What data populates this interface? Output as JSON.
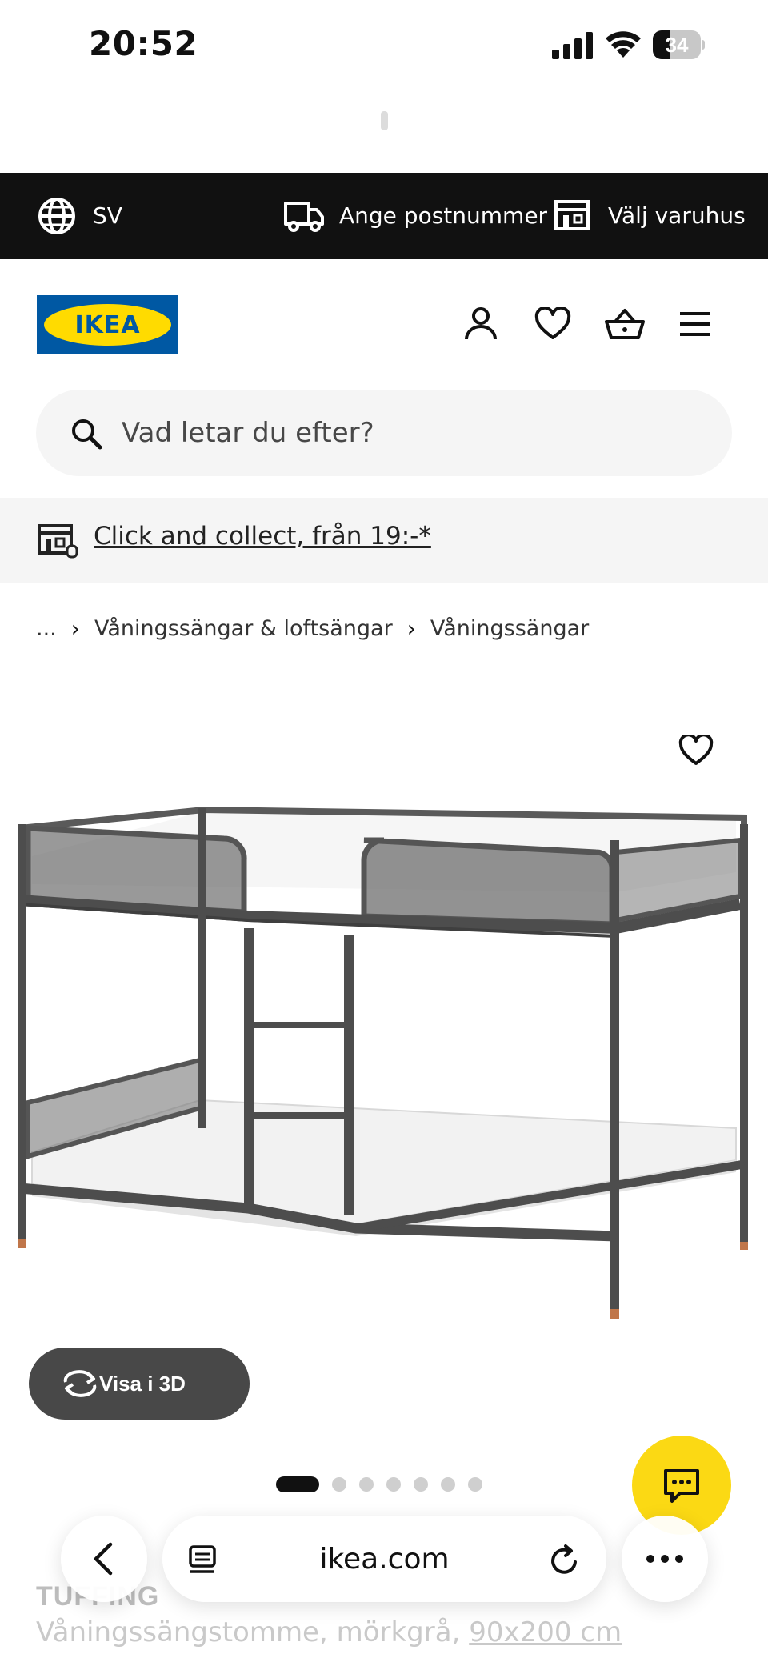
{
  "status_bar": {
    "time": "20:52",
    "battery": "34",
    "icons": [
      "signal-icon",
      "wifi-icon",
      "battery-icon"
    ]
  },
  "top_bar": {
    "language": "SV",
    "postcode_label": "Ange postnummer",
    "store_label": "Välj varuhus",
    "background": "#111111"
  },
  "header": {
    "logo_text": "IKEA",
    "logo_colors": {
      "blue": "#0058a3",
      "yellow": "#ffdb00"
    },
    "icons": [
      "account-icon",
      "favourites-icon",
      "cart-icon",
      "menu-icon"
    ]
  },
  "search": {
    "placeholder": "Vad letar du efter?"
  },
  "promo": {
    "link_text": "Click and collect, från 19:-*"
  },
  "breadcrumb": {
    "ellipsis": "...",
    "items": [
      "Våningssängar & loftsängar",
      "Våningssängar"
    ]
  },
  "gallery": {
    "view_3d_label": "Visa i 3D",
    "image_count": 7,
    "active_index": 0
  },
  "product": {
    "name": "TUFFING",
    "description": "Våningssängstomme, mörkgrå,",
    "size": "90x200 cm"
  },
  "browser_bar": {
    "url": "ikea.com"
  },
  "accent_colors": {
    "chat_button": "#fbd914",
    "view_3d_button": "#484848"
  }
}
